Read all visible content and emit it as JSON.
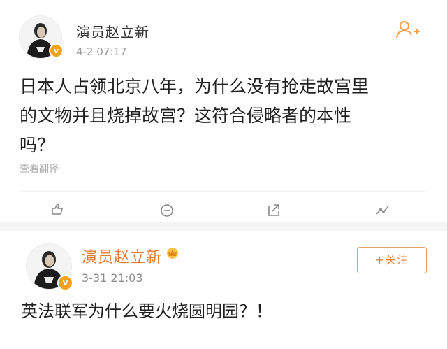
{
  "post1": {
    "author": "演员赵立新",
    "time": "4-2 07:17",
    "content_lines": [
      "日本人占领北京八年，为什么没有抢走故宫里",
      "的文物并且烧掉故宫？这符合侵略者的本性",
      "吗？"
    ],
    "translate_label": "查看翻译",
    "follow_icon": "add-person-icon",
    "actions": [
      "repost-icon",
      "comment-icon",
      "share-icon",
      "like-icon"
    ]
  },
  "post2": {
    "author": "演员赵立新",
    "time": "3-31 21:03",
    "follow_label": "+关注",
    "content": "英法联军为什么要火烧圆明园？！",
    "badge_icon": "vip-crown-icon"
  },
  "colors": {
    "verified_badge": "#f3a21a",
    "follow_accent": "#e0843a",
    "secondary_text": "#9a9a9a"
  }
}
